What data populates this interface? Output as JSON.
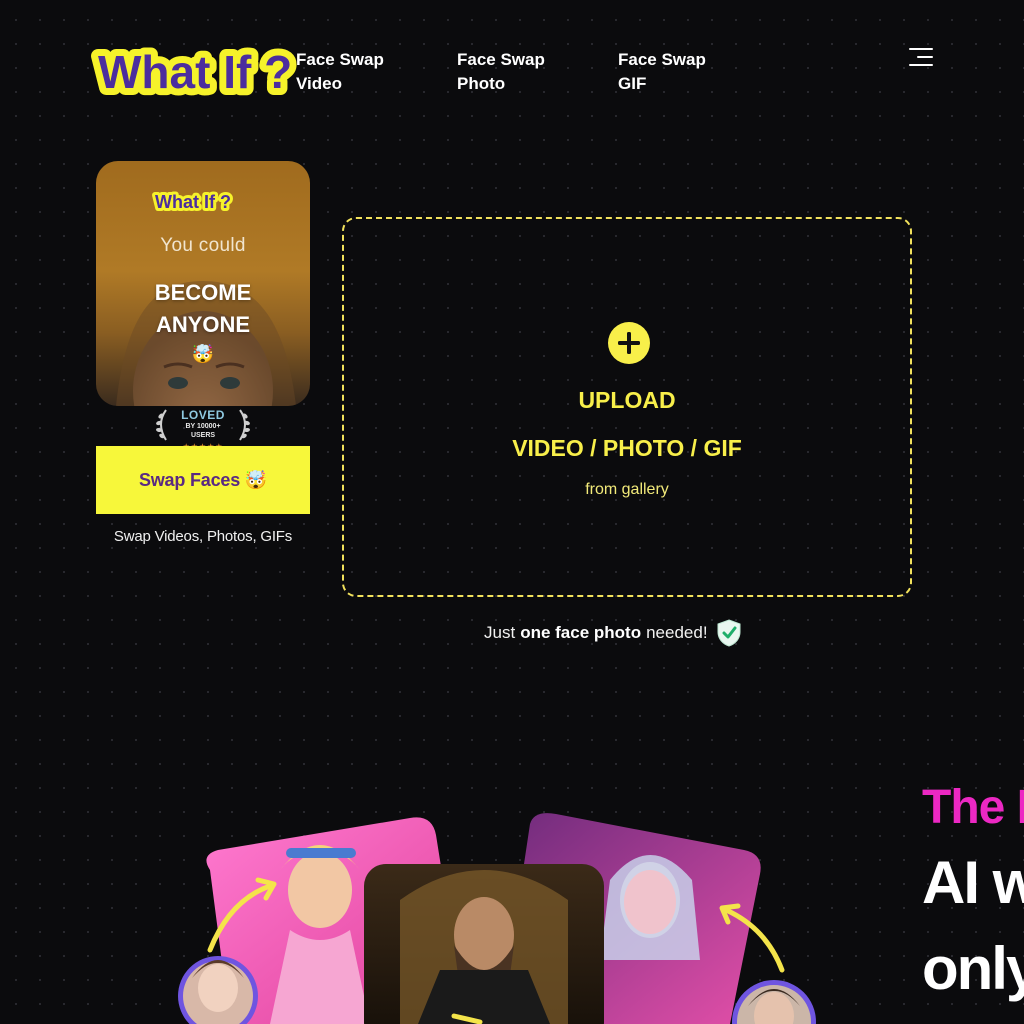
{
  "header": {
    "logo_text": "What If ?",
    "nav": [
      {
        "label": "Face Swap Video"
      },
      {
        "label": "Face Swap Photo"
      },
      {
        "label": "Face Swap GIF"
      }
    ],
    "menu_icon": "hamburger-menu-icon"
  },
  "promo": {
    "logo_text": "What If ?",
    "you_could": "You could",
    "become": "BECOME",
    "anyone": "ANYONE",
    "emoji": "🤯",
    "loved_title": "LOVED",
    "loved_by": "BY 10000+",
    "loved_users": "USERS",
    "stars": "★★★★★",
    "button_label": "Swap Faces 🤯",
    "caption": "Swap Videos, Photos, GIFs"
  },
  "upload": {
    "icon": "plus-circle-icon",
    "title": "UPLOAD",
    "types": "VIDEO / PHOTO / GIF",
    "subtitle": "from gallery"
  },
  "requirement": {
    "prefix": "Just",
    "emphasis": "one face photo",
    "suffix": "needed!",
    "icon": "shield-check-icon"
  },
  "hero": {
    "line1": "The B",
    "line2": "AI w",
    "line3": "only"
  },
  "colors": {
    "background": "#0b0b0d",
    "accent_yellow": "#f8ef4a",
    "button_yellow": "#f7f73a",
    "brand_purple": "#5a2a82",
    "magenta": "#ec28c3"
  }
}
